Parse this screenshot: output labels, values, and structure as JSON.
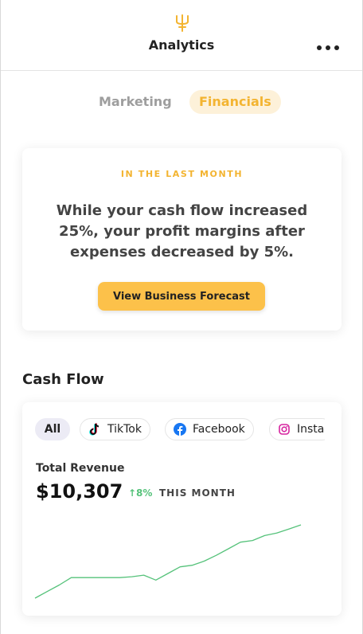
{
  "header": {
    "title": "Analytics",
    "logo_icon": "trident-icon",
    "menu_icon": "more-horizontal-icon"
  },
  "tabs": [
    {
      "label": "Marketing",
      "active": false
    },
    {
      "label": "Financials",
      "active": true
    }
  ],
  "insight": {
    "eyebrow": "IN THE LAST MONTH",
    "message": "While your cash flow increased 25%, your profit margins after expenses decreased by 5%.",
    "cta_label": "View Business Forecast"
  },
  "cash_flow": {
    "section_title": "Cash Flow",
    "filters": [
      {
        "label": "All",
        "icon": "",
        "selected": true
      },
      {
        "label": "TikTok",
        "icon": "tiktok-icon",
        "selected": false
      },
      {
        "label": "Facebook",
        "icon": "facebook-icon",
        "selected": false
      },
      {
        "label": "Insta",
        "icon": "instagram-icon",
        "selected": false
      }
    ],
    "revenue_label": "Total Revenue",
    "revenue_value": "$10,307",
    "delta": "↑8%",
    "delta_label": "THIS MONTH"
  },
  "colors": {
    "accent": "#f3b431",
    "accent_soft": "#fdf1d9",
    "button": "#fcc14a",
    "positive": "#55c27a",
    "chip_selected": "#ecebf5"
  },
  "chart_data": {
    "type": "line",
    "values": [
      0,
      8,
      16,
      25,
      25,
      25,
      25,
      25,
      26,
      28,
      22,
      30,
      38,
      40,
      45,
      52,
      60,
      68,
      70,
      76,
      79,
      84,
      89
    ]
  }
}
